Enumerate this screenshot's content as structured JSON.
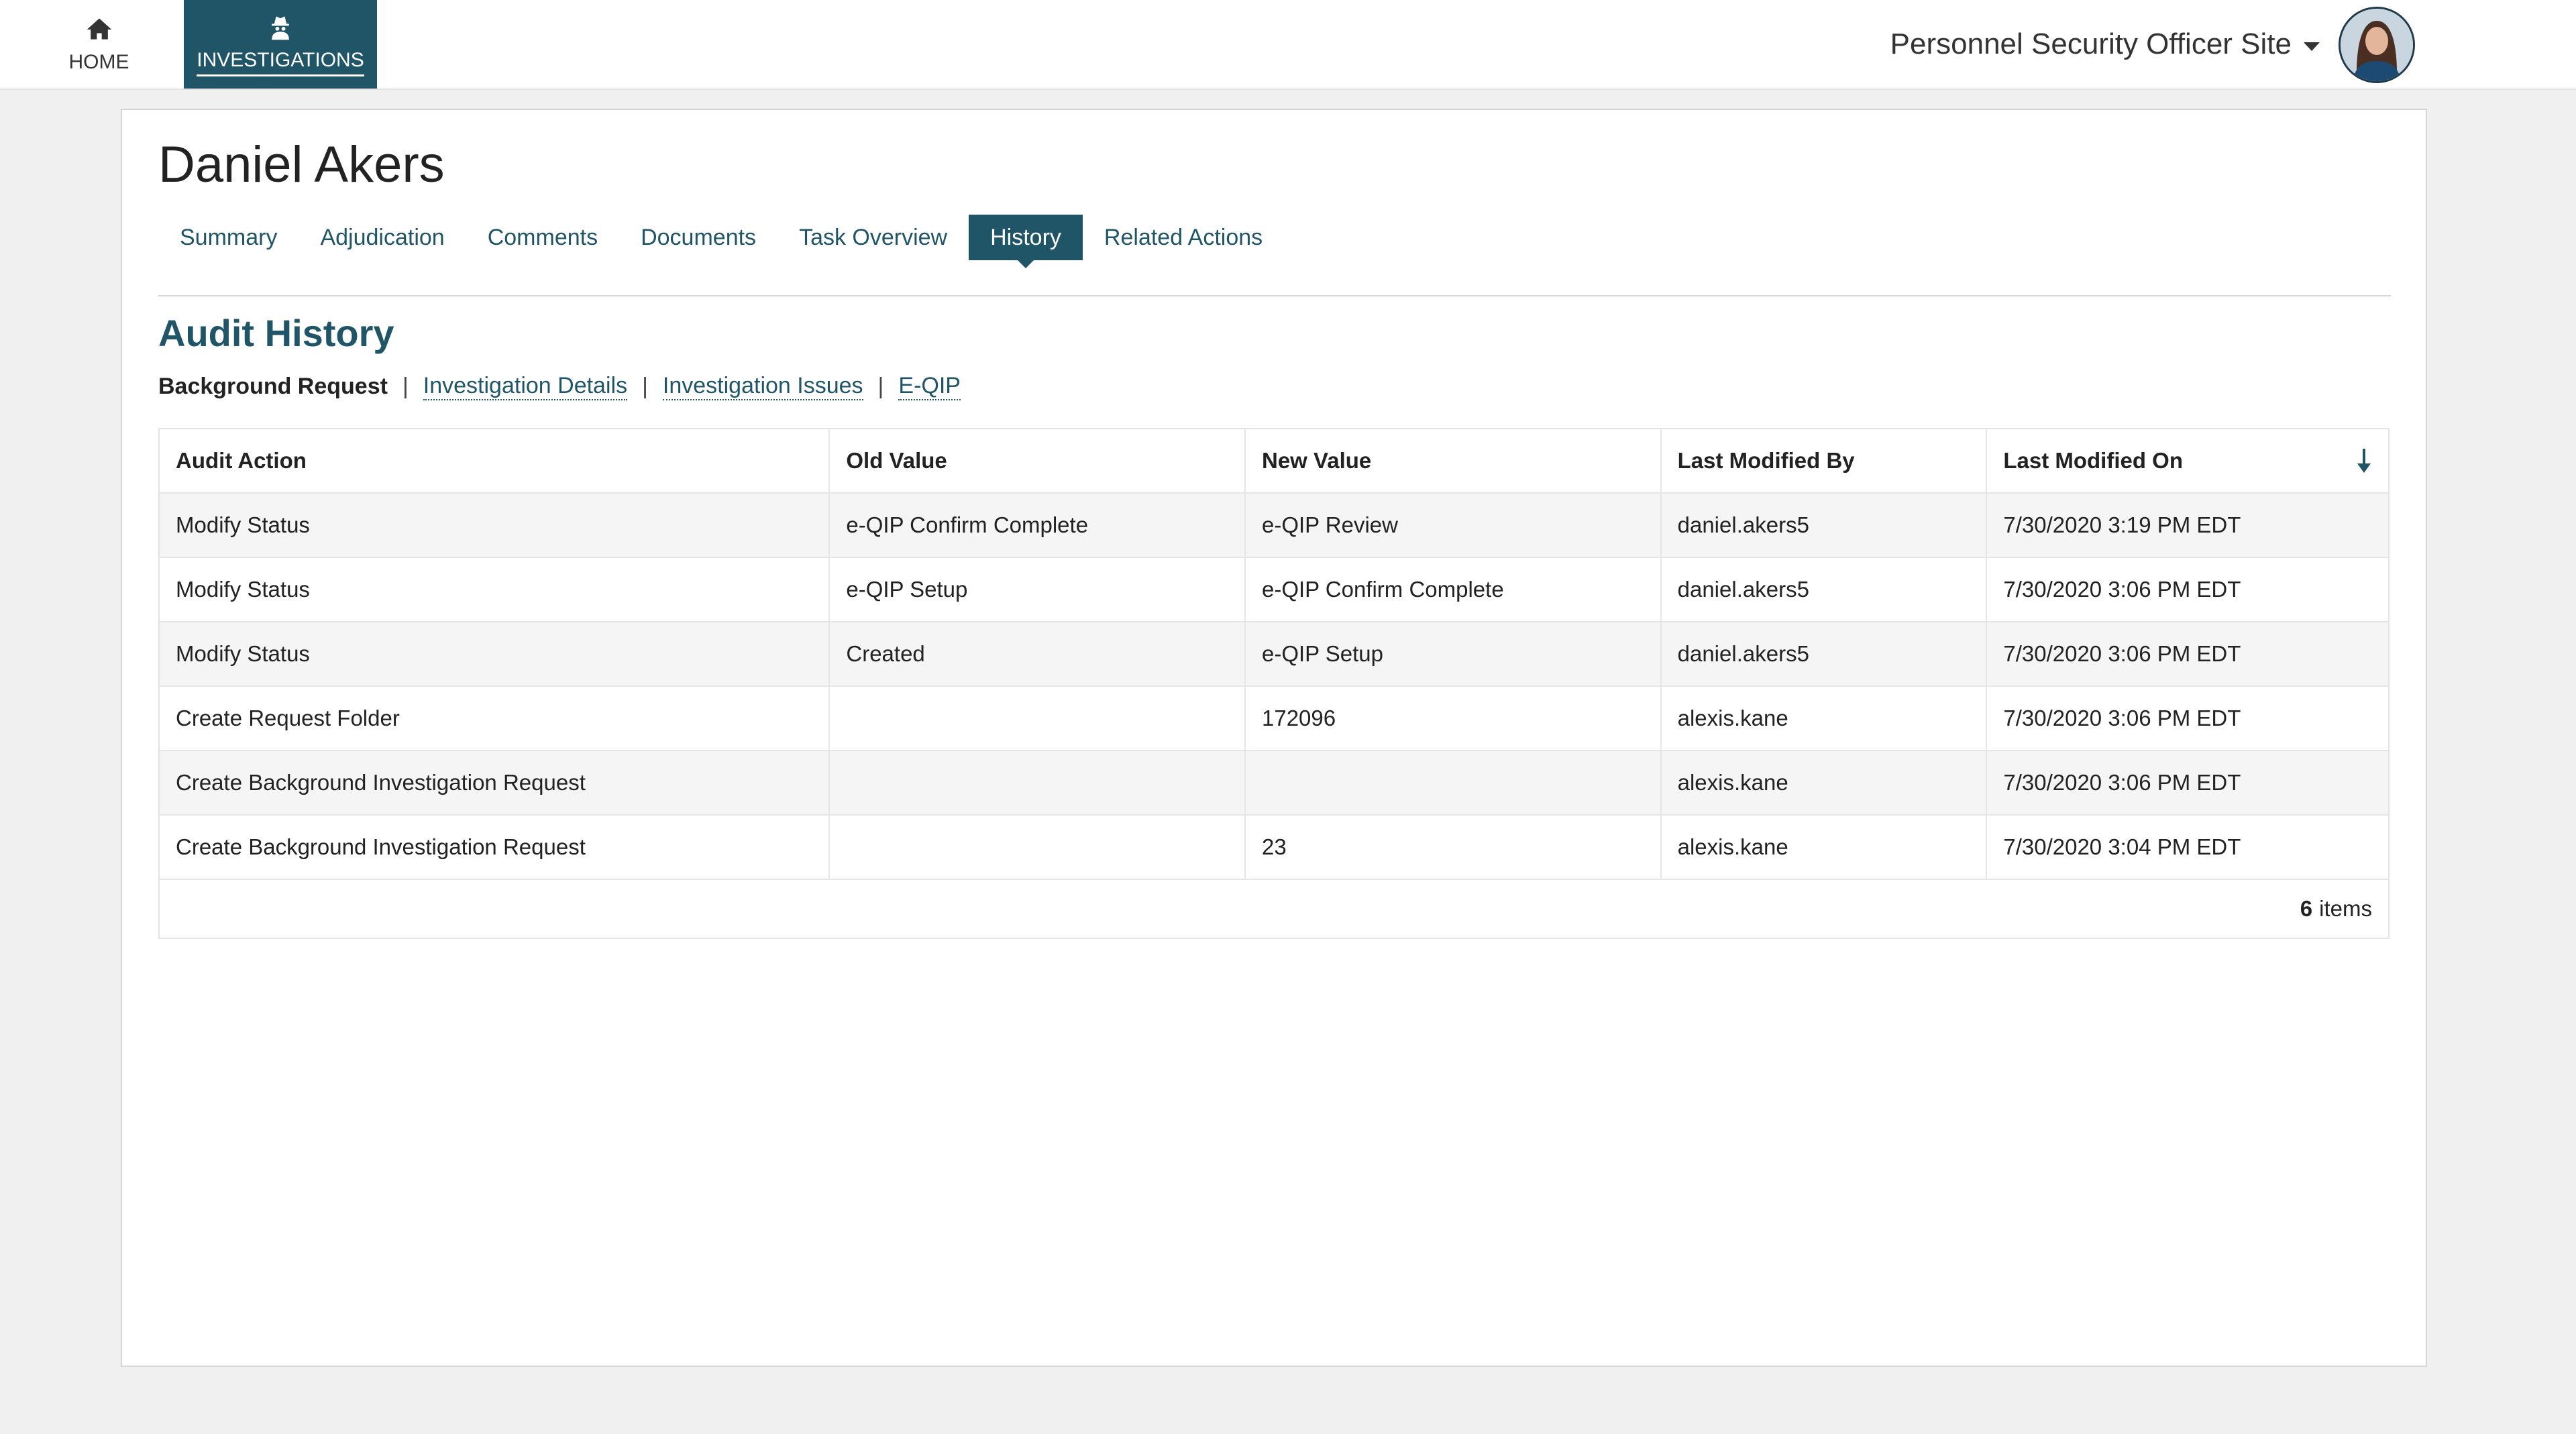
{
  "nav": {
    "home_label": "HOME",
    "investigations_label": "INVESTIGATIONS",
    "home_icon": "home-icon",
    "investigations_icon": "detective-icon"
  },
  "site": {
    "label": "Personnel Security Officer Site"
  },
  "page": {
    "title": "Daniel Akers"
  },
  "tabs": [
    {
      "label": "Summary"
    },
    {
      "label": "Adjudication"
    },
    {
      "label": "Comments"
    },
    {
      "label": "Documents"
    },
    {
      "label": "Task Overview"
    },
    {
      "label": "History",
      "active": true
    },
    {
      "label": "Related Actions"
    }
  ],
  "audit": {
    "title": "Audit History",
    "current": "Background Request",
    "links": [
      "Investigation Details",
      "Investigation Issues",
      "E-QIP"
    ],
    "separator": "|"
  },
  "table": {
    "columns": [
      "Audit Action",
      "Old Value",
      "New Value",
      "Last Modified By",
      "Last Modified On"
    ],
    "rows": [
      [
        "Modify Status",
        "e-QIP Confirm Complete",
        "e-QIP Review",
        "daniel.akers5",
        "7/30/2020 3:19 PM EDT"
      ],
      [
        "Modify Status",
        "e-QIP Setup",
        "e-QIP Confirm Complete",
        "daniel.akers5",
        "7/30/2020 3:06 PM EDT"
      ],
      [
        "Modify Status",
        "Created",
        "e-QIP Setup",
        "daniel.akers5",
        "7/30/2020 3:06 PM EDT"
      ],
      [
        "Create Request Folder",
        "",
        "172096",
        "alexis.kane",
        "7/30/2020 3:06 PM EDT"
      ],
      [
        "Create Background Investigation Request",
        "",
        "",
        "alexis.kane",
        "7/30/2020 3:06 PM EDT"
      ],
      [
        "Create Background Investigation Request",
        "",
        "23",
        "alexis.kane",
        "7/30/2020 3:04 PM EDT"
      ]
    ],
    "count": "6",
    "count_suffix": "items"
  },
  "colors": {
    "accent": "#1f5566"
  }
}
